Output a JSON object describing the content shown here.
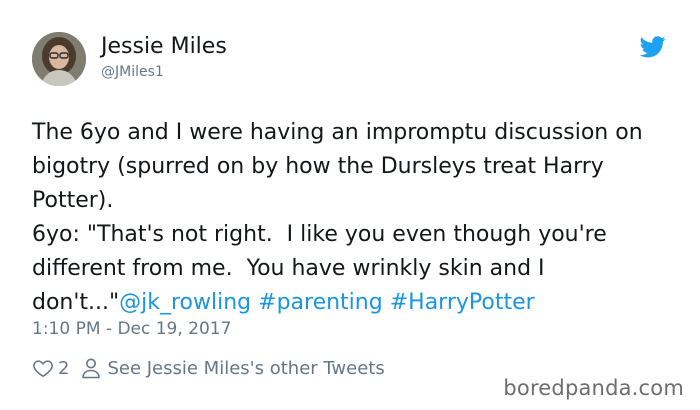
{
  "author": {
    "name": "Jessie Miles",
    "handle": "@JMiles1"
  },
  "tweet": {
    "text": "The 6yo and I were having an impromptu discussion on bigotry (spurred on by how the Dursleys treat Harry Potter).\n6yo: \"That's not right.  I like you even though you're different from me.  You have wrinkly skin and I don't...\"",
    "mention": "@jk_rowling",
    "hashtags": [
      "#parenting",
      "#HarryPotter"
    ],
    "timestamp": "1:10 PM - Dec 19, 2017"
  },
  "actions": {
    "likes": "2",
    "other_tweets_link": "See Jessie Miles's other Tweets"
  },
  "watermark": "boredpanda.com",
  "colors": {
    "link": "#1b95e0",
    "muted": "#657786",
    "twitter_blue": "#1da1f2"
  },
  "icons": {
    "bird": "twitter-bird-icon",
    "like": "heart-icon",
    "profile": "person-icon"
  }
}
